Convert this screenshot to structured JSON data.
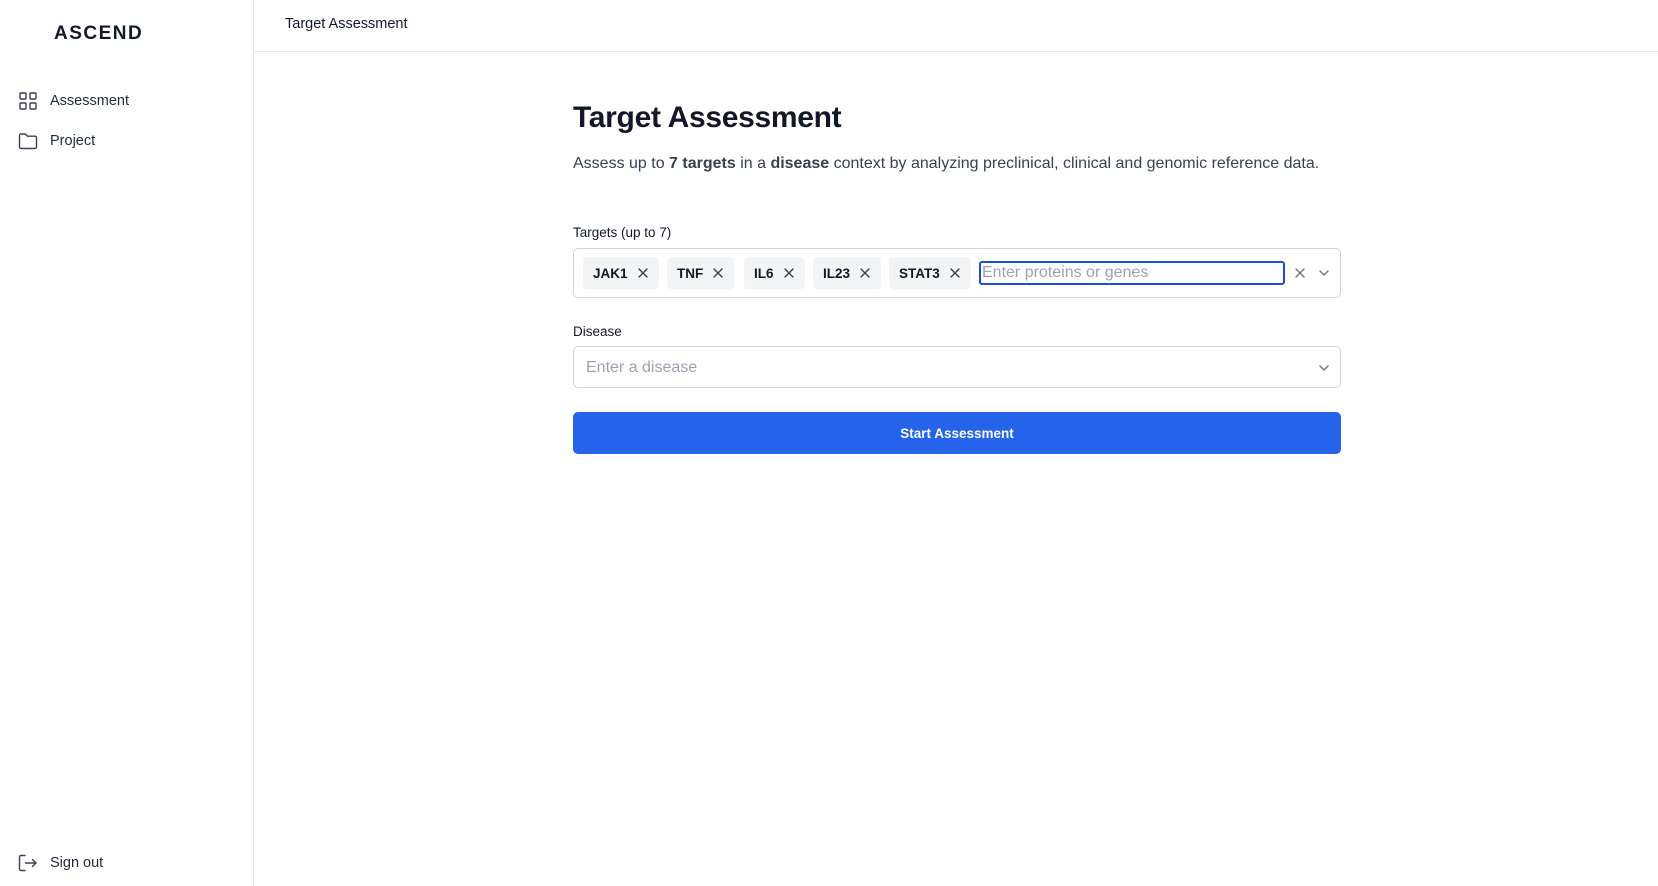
{
  "app": {
    "logo": "ASCEND"
  },
  "sidebar": {
    "items": [
      {
        "label": "Assessment",
        "icon": "grid-icon"
      },
      {
        "label": "Project",
        "icon": "folder-icon"
      }
    ],
    "signout": {
      "label": "Sign out",
      "icon": "sign-out-icon"
    }
  },
  "header": {
    "breadcrumb": "Target Assessment"
  },
  "main": {
    "title": "Target Assessment",
    "description": {
      "part1": "Assess up to ",
      "bold1": "7 targets",
      "part2": " in a ",
      "bold2": "disease",
      "part3": " context by analyzing preclinical, clinical and genomic reference data."
    },
    "targets": {
      "label": "Targets (up to 7)",
      "chips": [
        "JAK1",
        "TNF",
        "IL6",
        "IL23",
        "STAT3"
      ],
      "placeholder": "Enter proteins or genes",
      "value": ""
    },
    "disease": {
      "label": "Disease",
      "placeholder": "Enter a disease",
      "value": ""
    },
    "start_button": "Start Assessment"
  },
  "colors": {
    "primary": "#2563eb",
    "focus_border": "#1d4ed8",
    "chip_bg": "#f3f4f6",
    "border": "#d1d5db"
  }
}
